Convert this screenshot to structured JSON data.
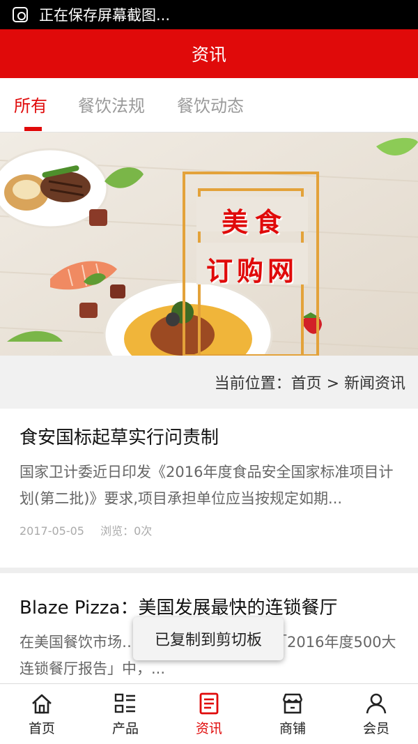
{
  "status_bar": {
    "text": "正在保存屏幕截图..."
  },
  "header": {
    "title": "资讯"
  },
  "tabs": [
    {
      "label": "所有",
      "active": true
    },
    {
      "label": "餐饮法规",
      "active": false
    },
    {
      "label": "餐饮动态",
      "active": false
    }
  ],
  "banner": {
    "line1": "美食",
    "line2": "订购网"
  },
  "breadcrumb": {
    "text": "当前位置：首页 > 新闻资讯"
  },
  "articles": [
    {
      "title": "食安国标起草实行问责制",
      "summary": "国家卫计委近日印发《2016年度食品安全国家标准项目计划(第二批)》要求,项目承担单位应当按规定如期...",
      "date": "2017-05-05",
      "views": "浏览：0次"
    },
    {
      "title": "Blaze Pizza：美国发展最快的连锁餐厅",
      "summary": "在美国餐饮市场……Technomic发布的「2016年度500大连锁餐厅报告」中，..."
    }
  ],
  "toast": {
    "text": "已复制到剪切板"
  },
  "bottom_nav": [
    {
      "label": "首页",
      "icon": "home-icon",
      "active": false
    },
    {
      "label": "产品",
      "icon": "product-list-icon",
      "active": false
    },
    {
      "label": "资讯",
      "icon": "news-icon",
      "active": true
    },
    {
      "label": "商铺",
      "icon": "shop-icon",
      "active": false
    },
    {
      "label": "会员",
      "icon": "member-icon",
      "active": false
    }
  ],
  "colors": {
    "accent": "#e00a0a",
    "status_bar": "#000000",
    "breadcrumb_bg": "#f1f1f1"
  }
}
